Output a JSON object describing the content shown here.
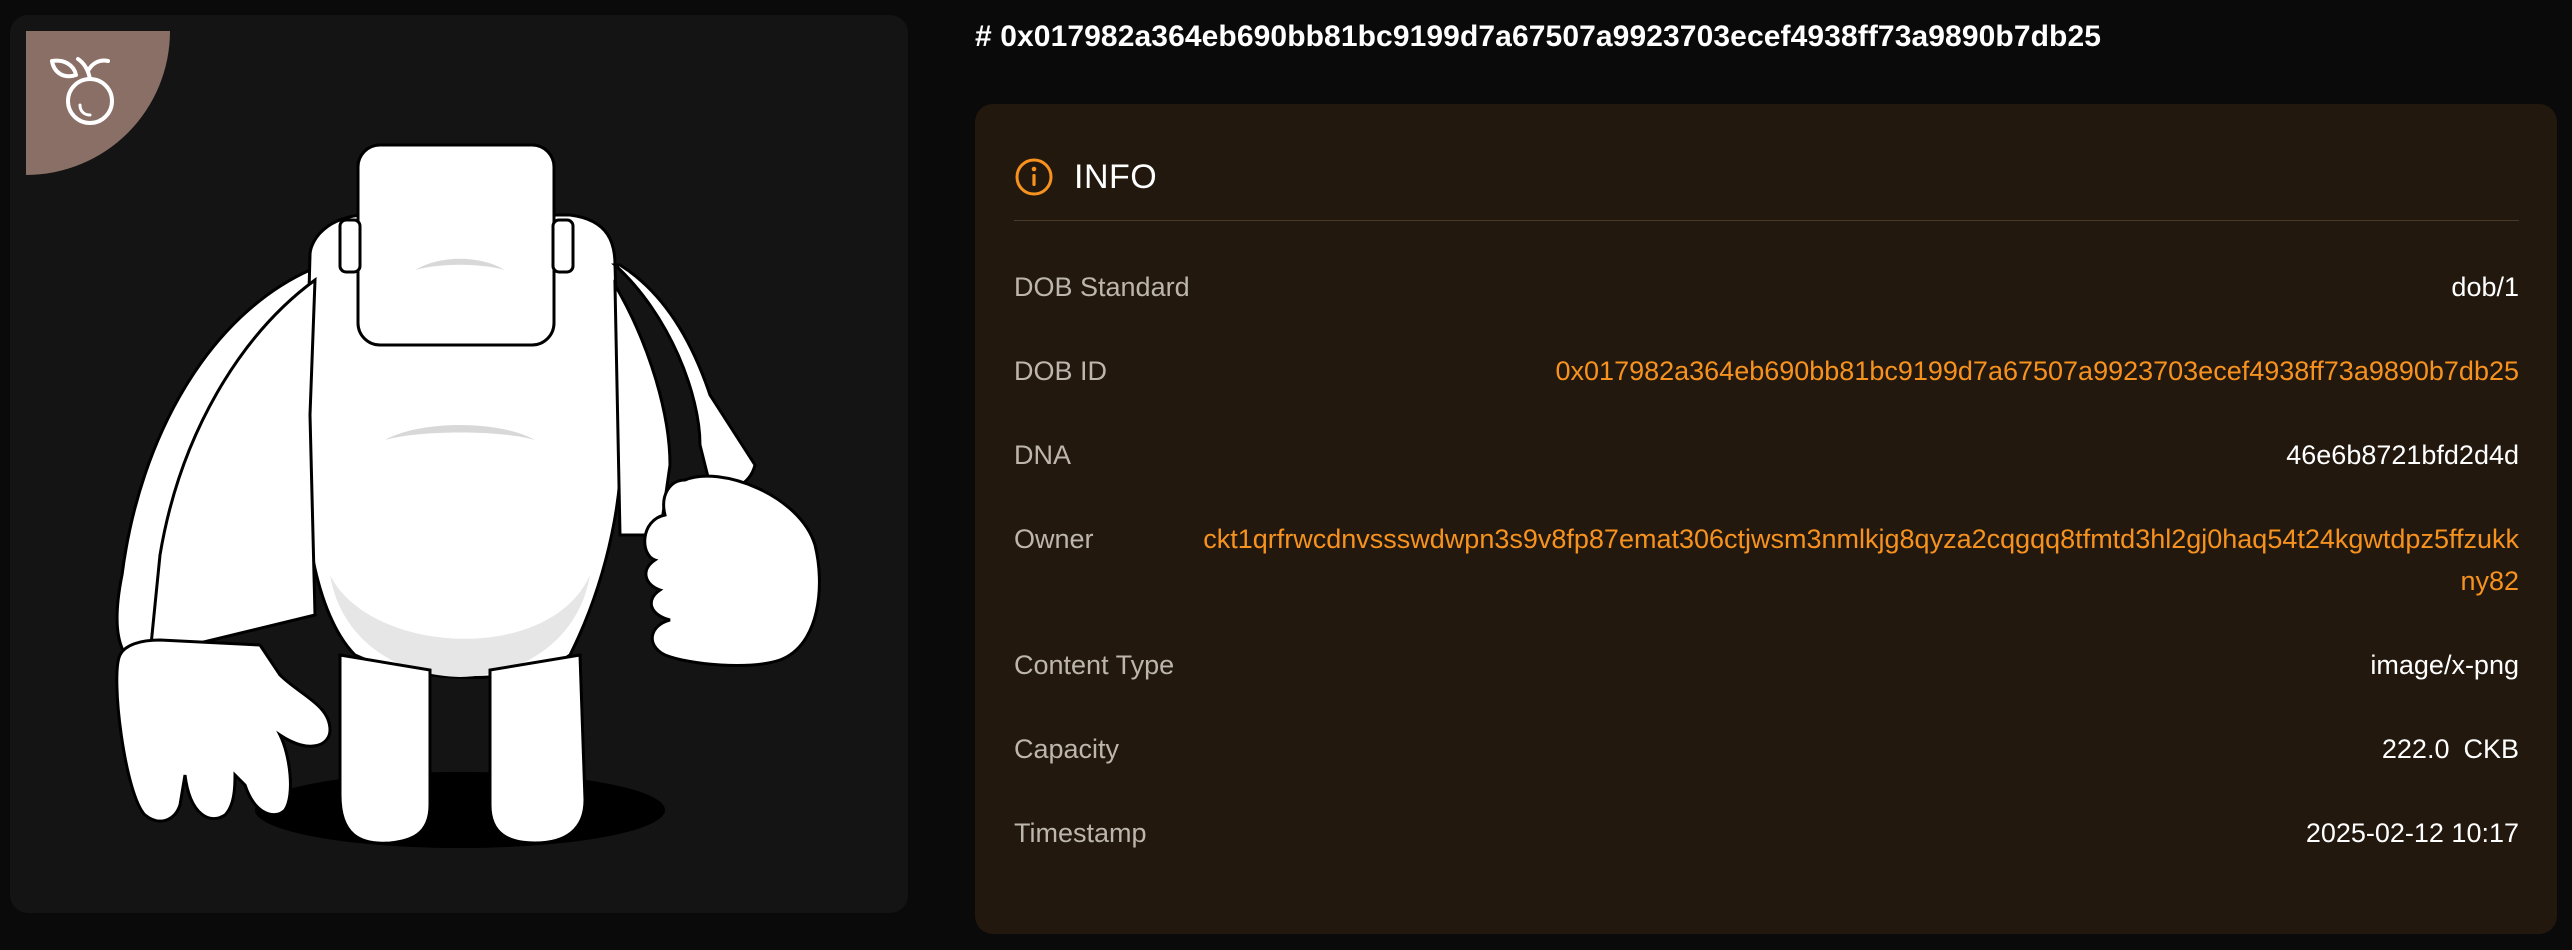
{
  "title": "# 0x017982a364eb690bb81bc9199d7a67507a9923703ecef4938ff73a9890b7db25",
  "image": {
    "badge_icon": "fruit-logo-icon",
    "subject": "white-ape-character"
  },
  "info": {
    "icon": "info-icon",
    "heading": "INFO",
    "rows": [
      {
        "label": "DOB Standard",
        "value": "dob/1"
      },
      {
        "label": "DOB ID",
        "value": "0x017982a364eb690bb81bc9199d7a67507a9923703ecef4938ff73a9890b7db25"
      },
      {
        "label": "DNA",
        "value": "46e6b8721bfd2d4d"
      },
      {
        "label": "Owner",
        "value": "ckt1qrfrwcdnvssswdwpn3s9v8fp87emat306ctjwsm3nmlkjg8qyza2cqgqq8tfmtd3hl2gj0haq54t24kgwtdpz5ffzukkny82"
      },
      {
        "label": "Content Type",
        "value": "image/x-png"
      },
      {
        "label": "Capacity",
        "value": "222.0",
        "unit": "CKB"
      },
      {
        "label": "Timestamp",
        "value": "2025-02-12 10:17"
      }
    ]
  },
  "colors": {
    "background": "#0a0a0a",
    "card": "#141414",
    "panel": "#22180e",
    "accent": "#f7921e",
    "badge": "#8a6f66"
  }
}
